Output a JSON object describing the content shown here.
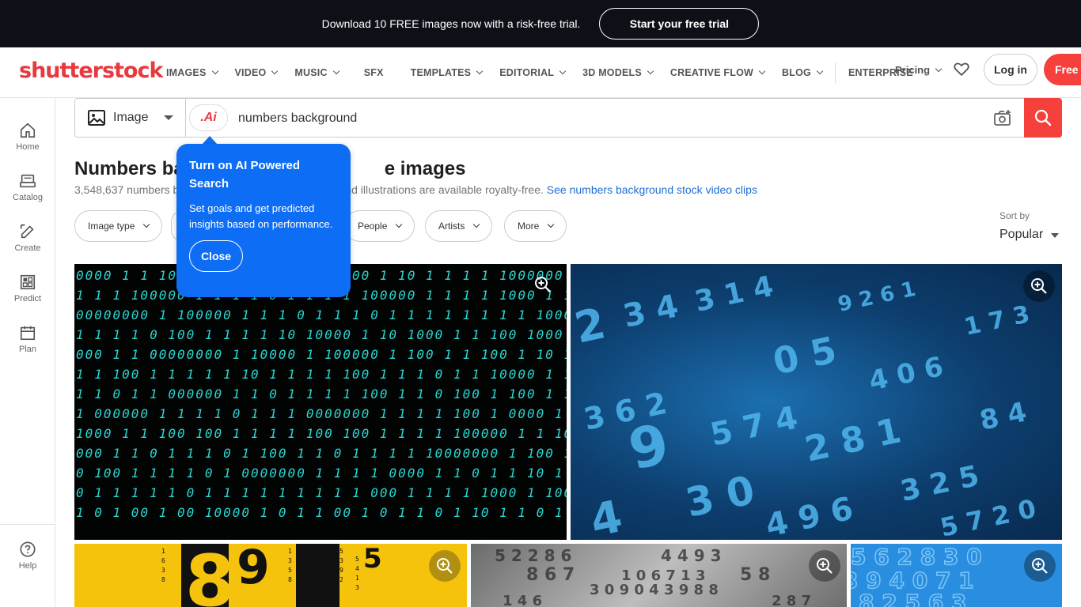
{
  "promo": {
    "text": "Download 10 FREE images now with a risk-free trial.",
    "button": "Start your free trial"
  },
  "header": {
    "logo": "shutterstock",
    "nav": [
      "IMAGES",
      "VIDEO",
      "MUSIC",
      "SFX",
      "TEMPLATES",
      "EDITORIAL",
      "3D MODELS",
      "CREATIVE FLOW",
      "BLOG",
      "ENTERPRISE"
    ],
    "pricing": "Pricing",
    "login": "Log in",
    "free_button": "Free t"
  },
  "sidebar": {
    "items": [
      "Home",
      "Catalog",
      "Create",
      "Predict",
      "Plan"
    ],
    "help": "Help"
  },
  "search": {
    "type": "Image",
    "ai_label": ".Ai",
    "query": "numbers background"
  },
  "results": {
    "title_left": "Numbers ba",
    "title_right": "e images",
    "count_left": "3,548,637 numbers b",
    "count_right": "nd illustrations are available royalty-free.",
    "video_link": "See numbers background stock video clips"
  },
  "filters": {
    "image_type": "Image type",
    "people": "People",
    "artists": "Artists",
    "more": "More"
  },
  "sort": {
    "label": "Sort by",
    "value": "Popular"
  },
  "tooltip": {
    "title": "Turn on AI Powered Search",
    "body": "Set goals and get predicted insights based on performance.",
    "close": "Close"
  },
  "colors": {
    "brand": "#e8393e",
    "accent_blue": "#0d6ef5",
    "link": "#1f6fd6",
    "banner_bg": "#0d1117"
  }
}
